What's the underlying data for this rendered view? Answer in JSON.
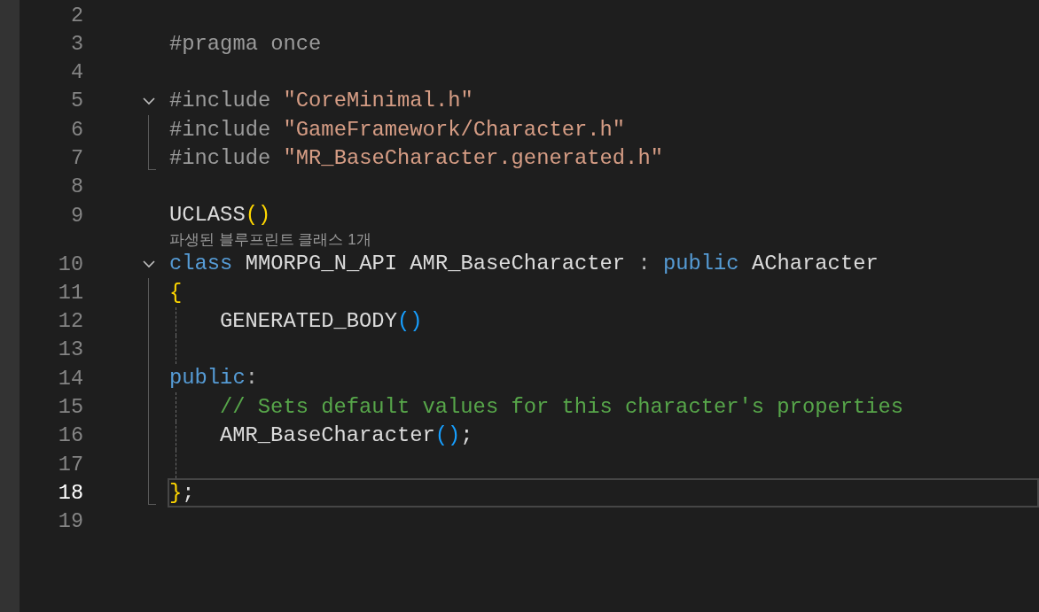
{
  "editor": {
    "lines": [
      {
        "kind": "code",
        "number": "2"
      },
      {
        "kind": "code",
        "number": "3",
        "tokens": [
          {
            "kind": "preproc",
            "text": "#pragma once"
          }
        ]
      },
      {
        "kind": "code",
        "number": "4"
      },
      {
        "kind": "code",
        "number": "5",
        "expanded": true,
        "tokens": [
          {
            "kind": "preproc",
            "text": "#include "
          },
          {
            "kind": "string",
            "text": "\"CoreMinimal.h\""
          }
        ]
      },
      {
        "kind": "code",
        "number": "6",
        "in_fold": true,
        "tokens": [
          {
            "kind": "preproc",
            "text": "#include "
          },
          {
            "kind": "string",
            "text": "\"GameFramework/Character.h\""
          }
        ]
      },
      {
        "kind": "code",
        "number": "7",
        "fold_end": true,
        "tokens": [
          {
            "kind": "preproc",
            "text": "#include "
          },
          {
            "kind": "string",
            "text": "\"MR_BaseCharacter.generated.h\""
          }
        ]
      },
      {
        "kind": "code",
        "number": "8"
      },
      {
        "kind": "code",
        "number": "9",
        "tokens": [
          {
            "kind": "plain",
            "text": "UCLASS"
          },
          {
            "kind": "bracket",
            "text": "()"
          }
        ]
      },
      {
        "kind": "codelens",
        "text": "파생된 블루프린트 클래스 1개"
      },
      {
        "kind": "code",
        "number": "10",
        "expanded": true,
        "tokens": [
          {
            "kind": "keyword",
            "text": "class"
          },
          {
            "kind": "plain",
            "text": " MMORPG_N_API AMR_BaseCharacter "
          },
          {
            "kind": "punct",
            "text": ": "
          },
          {
            "kind": "keyword",
            "text": "public"
          },
          {
            "kind": "plain",
            "text": " ACharacter"
          }
        ]
      },
      {
        "kind": "code",
        "number": "11",
        "in_fold": true,
        "tokens": [
          {
            "kind": "bracket",
            "text": "{"
          }
        ]
      },
      {
        "kind": "code",
        "number": "12",
        "in_fold": true,
        "guide": true,
        "indented": true,
        "tokens": [
          {
            "kind": "plain",
            "text": "GENERATED_BODY"
          },
          {
            "kind": "paren",
            "text": "()"
          }
        ]
      },
      {
        "kind": "code",
        "number": "13",
        "in_fold": true,
        "guide": true
      },
      {
        "kind": "code",
        "number": "14",
        "in_fold": true,
        "tokens": [
          {
            "kind": "keyword",
            "text": "public"
          },
          {
            "kind": "punct",
            "text": ":"
          }
        ]
      },
      {
        "kind": "code",
        "number": "15",
        "in_fold": true,
        "guide": true,
        "indented": true,
        "tokens": [
          {
            "kind": "comment",
            "text": "// Sets default values for this character's properties"
          }
        ]
      },
      {
        "kind": "code",
        "number": "16",
        "in_fold": true,
        "guide": true,
        "indented": true,
        "tokens": [
          {
            "kind": "plain",
            "text": "AMR_BaseCharacter"
          },
          {
            "kind": "paren",
            "text": "()"
          },
          {
            "kind": "plain",
            "text": ";"
          }
        ]
      },
      {
        "kind": "code",
        "number": "17",
        "in_fold": true,
        "guide": true
      },
      {
        "kind": "code",
        "number": "18",
        "fold_end": true,
        "current": true,
        "tokens": [
          {
            "kind": "bracket",
            "text": "}"
          },
          {
            "kind": "plain",
            "text": ";"
          }
        ]
      },
      {
        "kind": "code",
        "number": "19"
      }
    ]
  }
}
